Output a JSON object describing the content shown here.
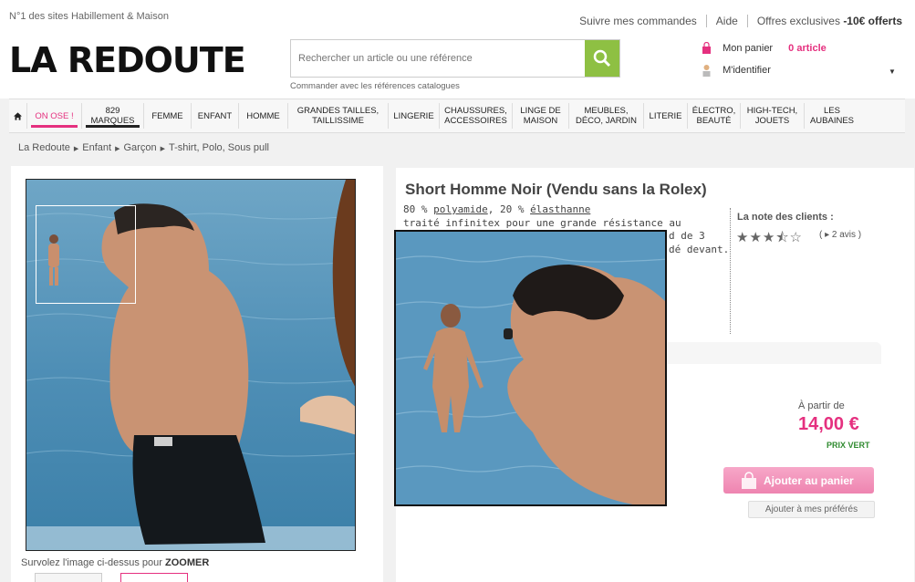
{
  "topbar": {
    "tagline": "N°1 des sites Habillement & Maison",
    "links": [
      "Suivre mes commandes",
      "Aide",
      "Offres exclusives"
    ],
    "offer": "-10€ offerts"
  },
  "header": {
    "logo": "LA REDOUTE",
    "search_placeholder": "Rechercher un article ou une référence",
    "catalog_link": "Commander avec les références catalogues",
    "cart_label": "Mon panier",
    "cart_count": "0 article",
    "login_label": "M'identifier"
  },
  "nav": {
    "items": [
      "ON OSE !",
      "829\nMARQUES",
      "FEMME",
      "ENFANT",
      "HOMME",
      "GRANDES TAILLES,\nTAILLISSIME",
      "LINGERIE",
      "CHAUSSURES,\nACCESSOIRES",
      "LINGE DE\nMAISON",
      "MEUBLES,\nDÉCO, JARDIN",
      "LITERIE",
      "ÉLECTRO,\nBEAUTÉ",
      "HIGH-TECH,\nJOUETS",
      "LES\nAUBAINES"
    ]
  },
  "breadcrumb": [
    "La Redoute",
    "Enfant",
    "Garçon",
    "T-shirt, Polo, Sous pull"
  ],
  "product": {
    "title": "Short Homme Noir (Vendu sans la Rolex)",
    "composition_pre": "80 % ",
    "composition_link1": "polyamide",
    "composition_mid": ", 20 % ",
    "composition_link2": "élasthanne",
    "desc_line": "traité infinitex pour une grande résistance au chlore. Taille",
    "desc_frag1": "d de 3",
    "desc_frag2": "dé devant.",
    "rating_label": "La note des clients :",
    "stars": "★★★⯪☆",
    "reviews": "( ▸ 2 avis )",
    "rating": 3.5,
    "price_from": "À partir de",
    "price": "14,00 €",
    "price_tag": "PRIX VERT",
    "add_to_cart": "Ajouter au panier",
    "add_to_fav": "Ajouter à mes préférés"
  },
  "zoom": {
    "hint_pre": "Survolez l'image ci-dessus pour ",
    "hint_bold": "ZOOMER"
  },
  "colors": {
    "accent_pink": "#e5307f",
    "search_green": "#8ec043",
    "price_green": "#2f8a2f"
  }
}
